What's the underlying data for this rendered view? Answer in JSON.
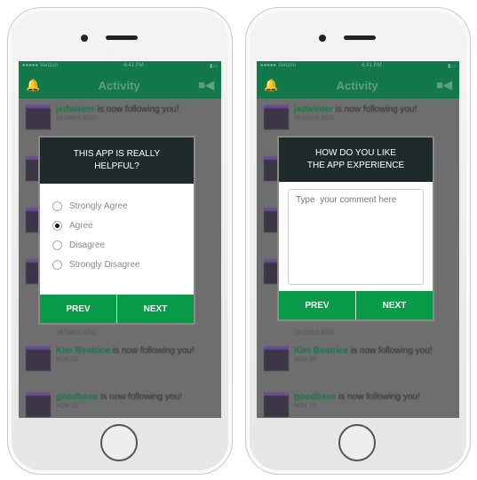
{
  "status": {
    "carrier": "●●●●● Verizon",
    "time": "6:41 PM"
  },
  "nav": {
    "title": "Activity",
    "bell_icon": "bell-icon",
    "video_icon": "video-camera-icon"
  },
  "feed": [
    {
      "user": "jxdwinter",
      "text": " is now following you!",
      "date": "15 DAYS AGO"
    },
    {
      "user": "",
      "text": "",
      "date": ""
    },
    {
      "user": "",
      "text": "",
      "date": ""
    },
    {
      "user": "",
      "text": "",
      "date": ""
    },
    {
      "user": "",
      "text": "",
      "date": "28 DAYS AGO"
    },
    {
      "user": "Kim Beatrice",
      "text": " is now following you!",
      "date": "NOV 20"
    },
    {
      "user": "goodbase",
      "text": " is now following you!",
      "date": "NOV 15"
    }
  ],
  "survey": {
    "question": "THIS APP IS REALLY HELPFUL?",
    "options": [
      "Strongly Agree",
      "Agree",
      "Disagree",
      "Strongly Disagree"
    ],
    "selected": "Agree",
    "prev": "PREV",
    "next": "NEXT"
  },
  "comment": {
    "question": "HOW  DO YOU LIKE THE APP EXPERIENCE",
    "placeholder": "Type  your comment here",
    "prev": "PREV",
    "next": "NEXT"
  },
  "colors": {
    "green": "#069a49",
    "header_dark": "#1f2b2a",
    "nav_green": "#13784a"
  }
}
